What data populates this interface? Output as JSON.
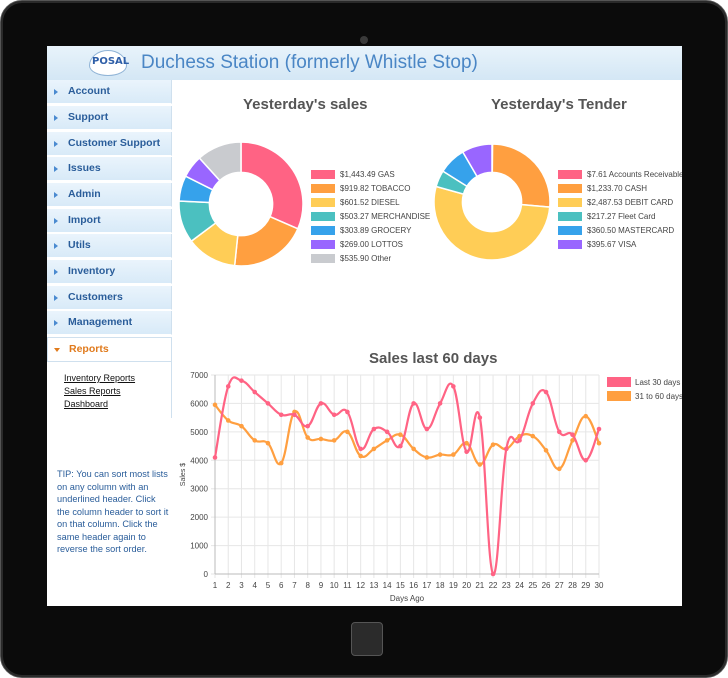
{
  "header": {
    "logo_text": "POSAL",
    "title": "Duchess Station (formerly Whistle Stop)"
  },
  "sidebar": {
    "items": [
      {
        "label": "Account"
      },
      {
        "label": "Support"
      },
      {
        "label": "Customer Support"
      },
      {
        "label": "Issues"
      },
      {
        "label": "Admin"
      },
      {
        "label": "Import"
      },
      {
        "label": "Utils"
      },
      {
        "label": "Inventory"
      },
      {
        "label": "Customers"
      },
      {
        "label": "Management"
      },
      {
        "label": "Reports"
      }
    ],
    "active_item": "Reports",
    "submenu": [
      "Inventory Reports",
      "Sales Reports",
      "Dashboard"
    ],
    "tip": "TIP: You can sort most lists on any column with an underlined header. Click the column header to sort it on that column. Click the same header again to reverse the sort order."
  },
  "chart_data": [
    {
      "type": "pie",
      "title": "Yesterday's sales",
      "donut": true,
      "labels": [
        "$1,443.49 GAS",
        "$919.82 TOBACCO",
        "$601.52 DIESEL",
        "$503.27 MERCHANDISE",
        "$303.89 GROCERY",
        "$269.00 LOTTOS",
        "$535.90 Other"
      ],
      "values": [
        1443.49,
        919.82,
        601.52,
        503.27,
        303.89,
        269.0,
        535.9
      ],
      "colors": [
        "#ff6384",
        "#ff9f40",
        "#ffcd56",
        "#4bc0c0",
        "#36a2eb",
        "#9966ff",
        "#c9cbcf"
      ],
      "legend": "right"
    },
    {
      "type": "pie",
      "title": "Yesterday's Tender",
      "donut": true,
      "labels": [
        "$7.61 Accounts Receivable",
        "$1,233.70 CASH",
        "$2,487.53 DEBIT CARD",
        "$217.27 Fleet Card",
        "$360.50 MASTERCARD",
        "$395.67 VISA"
      ],
      "values": [
        7.61,
        1233.7,
        2487.53,
        217.27,
        360.5,
        395.67
      ],
      "colors": [
        "#ff6384",
        "#ff9f40",
        "#ffcd56",
        "#4bc0c0",
        "#36a2eb",
        "#9966ff"
      ],
      "legend": "right"
    },
    {
      "type": "line",
      "title": "Sales last 60 days",
      "xlabel": "Days Ago",
      "ylabel": "Sales $",
      "x": [
        1,
        2,
        3,
        4,
        5,
        6,
        7,
        8,
        9,
        10,
        11,
        12,
        13,
        14,
        15,
        16,
        17,
        18,
        19,
        20,
        21,
        22,
        23,
        24,
        25,
        26,
        27,
        28,
        29,
        30
      ],
      "ylim": [
        0,
        7000
      ],
      "yticks": [
        0,
        1000,
        2000,
        3000,
        4000,
        5000,
        6000,
        7000
      ],
      "grid": true,
      "legend": "right",
      "series": [
        {
          "name": "Last 30 days",
          "color": "#ff6384",
          "values": [
            4100,
            6600,
            6800,
            6400,
            6000,
            5600,
            5600,
            5200,
            6000,
            5600,
            5700,
            4400,
            5100,
            5000,
            4500,
            6000,
            5100,
            6000,
            6600,
            4300,
            5500,
            0,
            4400,
            4700,
            6000,
            6400,
            5000,
            4900,
            4000,
            5100
          ]
        },
        {
          "name": "31 to 60 days",
          "color": "#ff9f40",
          "values": [
            5950,
            5400,
            5200,
            4700,
            4600,
            3900,
            5700,
            4800,
            4750,
            4700,
            5000,
            4150,
            4400,
            4700,
            4900,
            4400,
            4100,
            4200,
            4200,
            4600,
            3850,
            4550,
            4400,
            4850,
            4850,
            4350,
            3700,
            4700,
            5550,
            4600
          ]
        }
      ]
    }
  ]
}
